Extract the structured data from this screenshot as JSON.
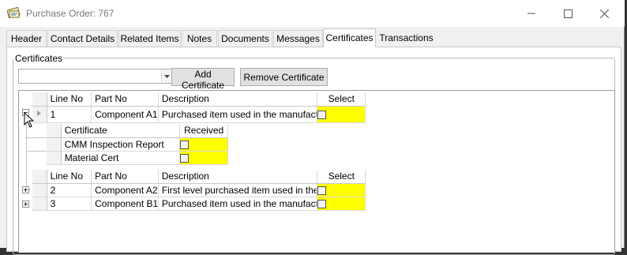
{
  "window": {
    "title": "Purchase Order: 767"
  },
  "tabs": [
    {
      "label": "Header"
    },
    {
      "label": "Contact Details"
    },
    {
      "label": "Related Items"
    },
    {
      "label": "Notes"
    },
    {
      "label": "Documents"
    },
    {
      "label": "Messages"
    },
    {
      "label": "Certificates",
      "active": true
    },
    {
      "label": "Transactions"
    }
  ],
  "certificates": {
    "group_title": "Certificates",
    "combo_value": "",
    "add_button": "Add Certificate",
    "remove_button": "Remove Certificate",
    "grid": {
      "columns": [
        "Line No",
        "Part No",
        "Description",
        "Select"
      ],
      "rows": [
        {
          "line_no": "1",
          "part_no": "Component A1",
          "description": "Purchased item used in the manufactu...",
          "select": false,
          "expanded": true
        }
      ],
      "child": {
        "columns": [
          "Certificate",
          "Received"
        ],
        "rows": [
          {
            "certificate": "CMM Inspection Report",
            "received": false
          },
          {
            "certificate": "Material Cert",
            "received": false
          }
        ]
      },
      "rows2": [
        {
          "line_no": "2",
          "part_no": "Component A2",
          "description": "First level purchased item used in the ...",
          "select": false
        },
        {
          "line_no": "3",
          "part_no": "Component B1",
          "description": "Purchased item used in the manufactu...",
          "select": false
        }
      ]
    }
  },
  "colors": {
    "highlight": "#ffff00"
  }
}
